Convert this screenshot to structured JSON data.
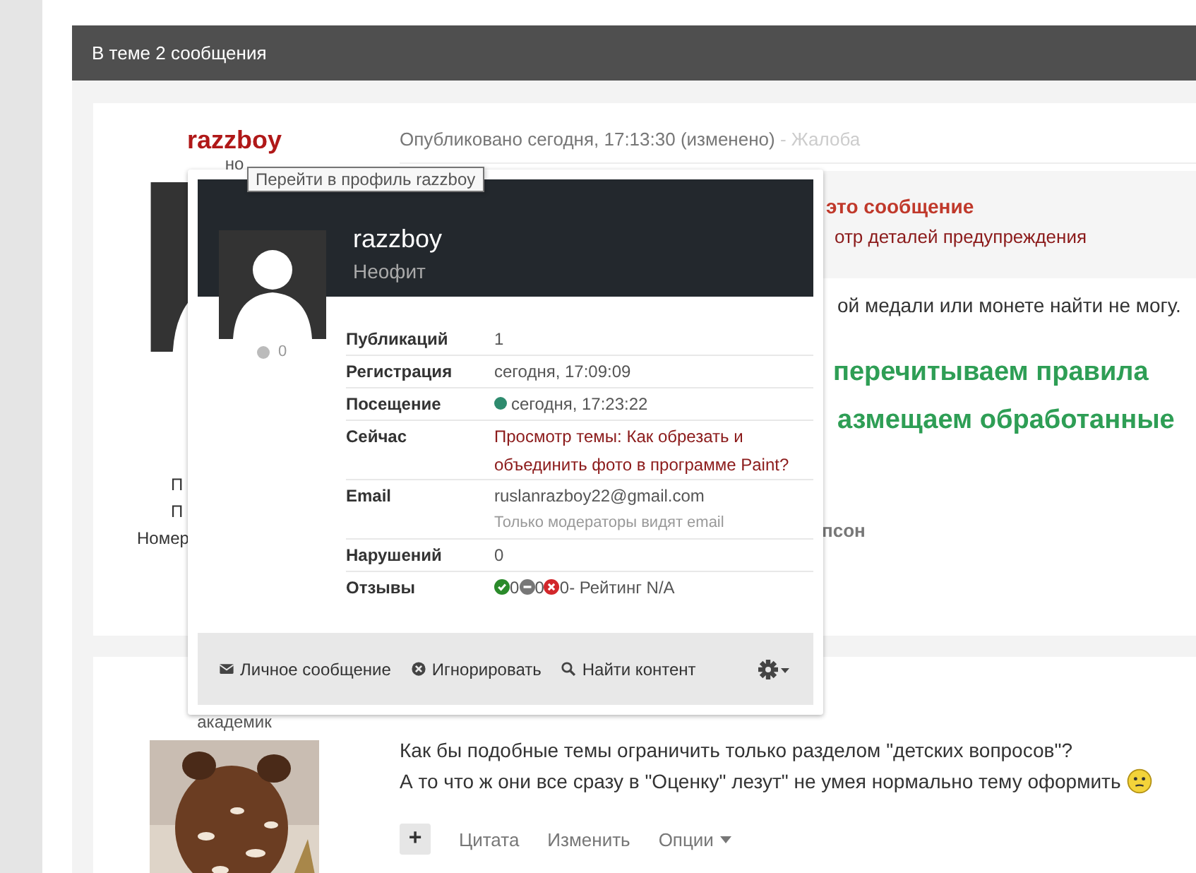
{
  "page_header": {
    "title": "В теме 2 сообщения"
  },
  "posts": [
    {
      "author": {
        "name": "razzboy",
        "rank": "но",
        "info_lines": [
          {
            "text": "П"
          },
          {
            "text": "П"
          },
          {
            "text": "Номер"
          }
        ]
      },
      "meta": {
        "published": "Опубликовано сегодня, 17:13:30 (изменено)",
        "separator": " - ",
        "report": "Жалоба"
      },
      "warning": {
        "title": "это сообщение",
        "link": "отр деталей предупреждения"
      },
      "body": [
        {
          "kind": "text",
          "text": "ой медали или монете найти не могу."
        },
        {
          "kind": "highlight",
          "text": "перечитываем правила"
        },
        {
          "kind": "highlight",
          "text": "азмещаем обработанные"
        },
        {
          "kind": "signature",
          "text": "псон"
        }
      ]
    },
    {
      "author": {
        "rank": "академик"
      },
      "body": [
        {
          "kind": "text",
          "text": "Как бы подобные темы ограничить только разделом \"детских вопросов\"?"
        },
        {
          "kind": "text",
          "text": "А то что ж они все сразу в \"Оценку\" лезут\" не умея нормально тему оформить",
          "emoji": true
        }
      ],
      "actions": [
        {
          "kind": "plus",
          "label": "+"
        },
        {
          "kind": "link",
          "label": "Цитата"
        },
        {
          "kind": "link",
          "label": "Изменить"
        },
        {
          "kind": "menu",
          "label": "Опции"
        }
      ]
    }
  ],
  "profile_card": {
    "name": "razzboy",
    "title": "Неофит",
    "reputation": "0",
    "fields": [
      {
        "kind": "text",
        "label": "Публикаций",
        "value": "1"
      },
      {
        "kind": "text",
        "label": "Регистрация",
        "value": "сегодня, 17:09:09"
      },
      {
        "kind": "visit",
        "label": "Посещение",
        "value": "сегодня, 17:23:22",
        "online": true
      },
      {
        "kind": "link",
        "label": "Сейчас",
        "value": "Просмотр темы: Как обрезать и объединить фото в программе Paint?"
      },
      {
        "kind": "email",
        "label": "Email",
        "value": "ruslanrazboy22@gmail.com",
        "note": "Только модераторы видят email"
      },
      {
        "kind": "text",
        "label": "Нарушений",
        "value": "0"
      },
      {
        "kind": "feedback",
        "label": "Отзывы",
        "positive": "0",
        "neutral": "0",
        "negative": "0",
        "rating": "- Рейтинг N/A"
      }
    ],
    "actions": [
      {
        "label": "Личное сообщение"
      },
      {
        "label": "Игнорировать"
      },
      {
        "label": "Найти контент"
      }
    ],
    "settings_menu": true
  },
  "tooltip": {
    "text": "Перейти в профиль razzboy"
  }
}
